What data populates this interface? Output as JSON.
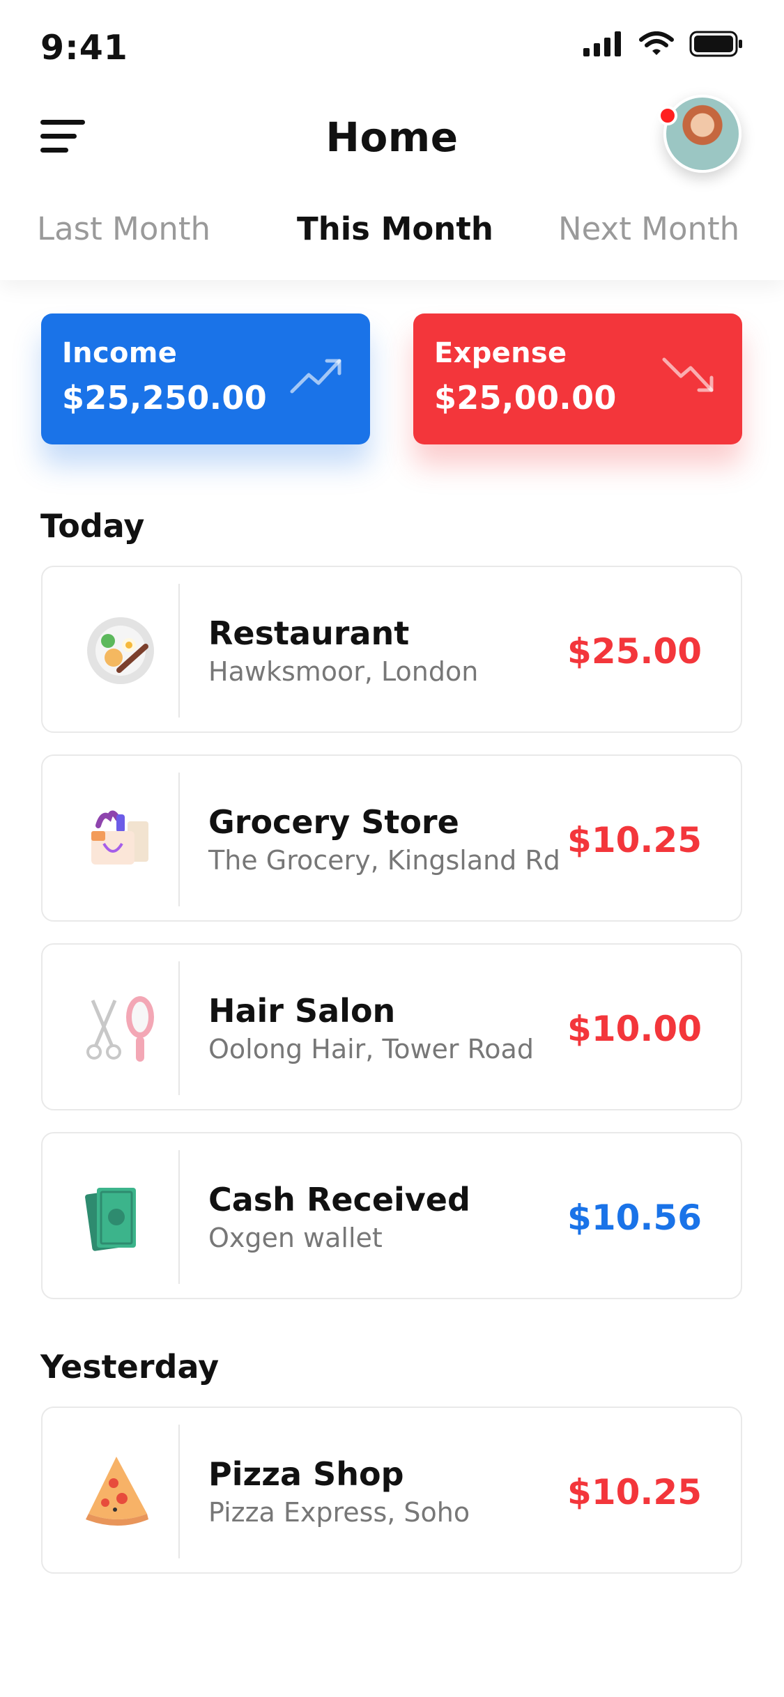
{
  "status_bar": {
    "time": "9:41"
  },
  "header": {
    "title": "Home"
  },
  "tabs": [
    {
      "label": "Last Month",
      "active": false
    },
    {
      "label": "This Month",
      "active": true
    },
    {
      "label": "Next Month",
      "active": false
    }
  ],
  "summary": {
    "income": {
      "label": "Income",
      "amount": "$25,250.00",
      "icon": "trend-up-icon",
      "color": "#1a73e8"
    },
    "expense": {
      "label": "Expense",
      "amount": "$25,00.00",
      "icon": "trend-down-icon",
      "color": "#f3363b"
    }
  },
  "sections": [
    {
      "title": "Today",
      "items": [
        {
          "name": "Restaurant",
          "sub": "Hawksmoor, London",
          "amount": "$25.00",
          "type": "expense",
          "icon": "restaurant-plate-icon"
        },
        {
          "name": "Grocery Store",
          "sub": "The Grocery, Kingsland Rd",
          "amount": "$10.25",
          "type": "expense",
          "icon": "grocery-bag-icon"
        },
        {
          "name": "Hair Salon",
          "sub": "Oolong Hair, Tower Road",
          "amount": "$10.00",
          "type": "expense",
          "icon": "scissors-brush-icon"
        },
        {
          "name": "Cash Received",
          "sub": "Oxgen wallet",
          "amount": "$10.56",
          "type": "income",
          "icon": "cash-icon"
        }
      ]
    },
    {
      "title": "Yesterday",
      "items": [
        {
          "name": "Pizza Shop",
          "sub": "Pizza Express, Soho",
          "amount": "$10.25",
          "type": "expense",
          "icon": "pizza-slice-icon"
        }
      ]
    }
  ],
  "colors": {
    "expense": "#f3363b",
    "income": "#1a73e8",
    "muted": "#9a9a9a"
  }
}
